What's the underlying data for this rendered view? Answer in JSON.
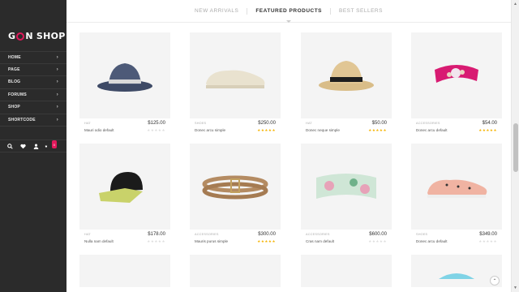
{
  "brand": {
    "logo_prefix": "G",
    "logo_suffix": "N",
    "logo_word": "SHOP",
    "accent": "#e2185b"
  },
  "menu": [
    {
      "label": "HOME"
    },
    {
      "label": "PAGE"
    },
    {
      "label": "BLOG"
    },
    {
      "label": "FORUMS"
    },
    {
      "label": "SHOP"
    },
    {
      "label": "SHORTCODE"
    }
  ],
  "cart_count": "0",
  "tabs": [
    {
      "label": "NEW ARRIVALS"
    },
    {
      "label": "FEATURED PRODUCTS"
    },
    {
      "label": "BEST SELLERS"
    }
  ],
  "products": [
    {
      "category": "HAT",
      "name": "Mauri odio default",
      "price": "$125.00",
      "rating": 0
    },
    {
      "category": "SHOES",
      "name": "Donec arcu simple",
      "price": "$250.00",
      "rating": 5
    },
    {
      "category": "HAT",
      "name": "Donec neque simple",
      "price": "$50.00",
      "rating": 5
    },
    {
      "category": "ACCESSORIES",
      "name": "Donec arcu default",
      "price": "$54.00",
      "rating": 5
    },
    {
      "category": "HAT",
      "name": "Nulla nam default",
      "price": "$178.00",
      "rating": 0
    },
    {
      "category": "ACCESSORIES",
      "name": "Mauris purus simple",
      "price": "$300.00",
      "rating": 5
    },
    {
      "category": "ACCESSORIES",
      "name": "Cras nam default",
      "price": "$600.00",
      "rating": 0
    },
    {
      "category": "SHOES",
      "name": "Donec arcu default",
      "price": "$349.00",
      "rating": 0
    }
  ]
}
